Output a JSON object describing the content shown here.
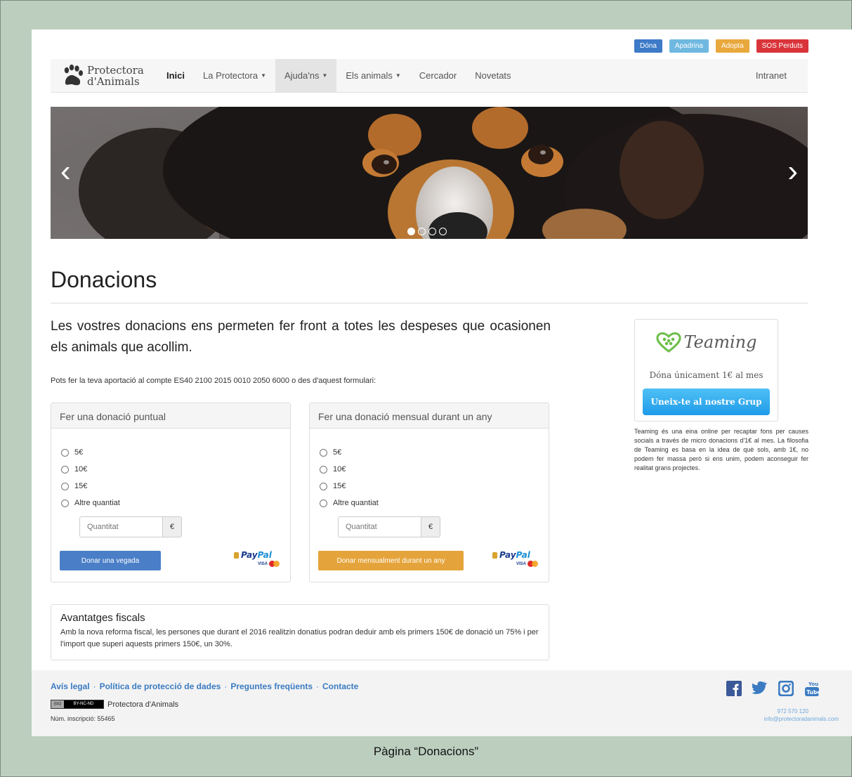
{
  "colors": {
    "dona": "#3d7ac8",
    "apadrina": "#6fb8e0",
    "adopta": "#e8a83c",
    "sos": "#d9343a",
    "donate_once": "#4a7fc8",
    "donate_monthly": "#e5a43b",
    "link": "#3a7bc2",
    "teaming_green": "#6cbf4a",
    "facebook": "#3b5998",
    "twitter": "#3a7bc2"
  },
  "top_buttons": [
    "Dóna",
    "Apadrina",
    "Adopta",
    "SOS Perduts"
  ],
  "logo": {
    "line1": "Protectora",
    "line2": "d'Animals",
    "icon": "paw-icon"
  },
  "nav": {
    "items": [
      {
        "label": "Inici",
        "dropdown": false
      },
      {
        "label": "La Protectora",
        "dropdown": true
      },
      {
        "label": "Ajuda'ns",
        "dropdown": true
      },
      {
        "label": "Els animals",
        "dropdown": true
      },
      {
        "label": "Cercador",
        "dropdown": false
      },
      {
        "label": "Novetats",
        "dropdown": false
      }
    ],
    "right": "Intranet"
  },
  "carousel": {
    "prev_icon": "‹",
    "next_icon": "›",
    "slides": 4,
    "active": 1
  },
  "page": {
    "title": "Donacions",
    "lead": "Les vostres donacions ens permeten fer front a totes les despeses que ocasionen els animals que acollim.",
    "account_text": "Pots fer la teva aportació al compte ES40 2100 2015 0010 2050 6000 o des d'aquest formulari:"
  },
  "panels": [
    {
      "heading": "Fer una donació puntual",
      "options": [
        "5€",
        "10€",
        "15€",
        "Altre quantiat"
      ],
      "placeholder": "Quantitat",
      "addon": "€",
      "button": "Donar una vegada"
    },
    {
      "heading": "Fer una donació mensual durant un any",
      "options": [
        "5€",
        "10€",
        "15€",
        "Altre quantiat"
      ],
      "placeholder": "Quantitat",
      "addon": "€",
      "button": "Donar mensualment durant un any"
    }
  ],
  "paypal": {
    "pay": "Pay",
    "pal": "Pal",
    "visa": "VISA"
  },
  "fiscal": {
    "heading": "Avantatges fiscals",
    "text": "Amb la nova reforma fiscal, les persones que durant el 2016 realitzin donatius podran deduir amb els primers 150€ de donació un 75% i per l'import que superi aquests primers 150€, un 30%."
  },
  "teaming": {
    "name": "Teaming",
    "tagline": "Dóna únicament 1€ al mes",
    "button": "Uneix-te al nostre Grup",
    "description": "Teaming és una eina online per recaptar fons per causes socials a través de micro donacions d'1€ al mes. La filosofia de Teaming es basa en la idea de què sols, amb 1€, no podem fer massa però si ens unim, podem aconseguir fer realitat grans projectes."
  },
  "footer": {
    "links": [
      "Avís legal",
      "Política de protecció de dades",
      "Preguntes freqüents",
      "Contacte"
    ],
    "cc_badge": [
      "(cc)",
      "BY-NC-ND"
    ],
    "org": "Protectora d'Animals",
    "inscription": "Núm. inscripció: 55465",
    "phone": "972 570 120",
    "email": "info@protectoradanimals.com",
    "social": [
      "facebook-icon",
      "twitter-icon",
      "instagram-icon",
      "youtube-icon"
    ],
    "youtube_text": [
      "You",
      "Tube"
    ]
  },
  "caption": "Pàgina “Donacions”"
}
